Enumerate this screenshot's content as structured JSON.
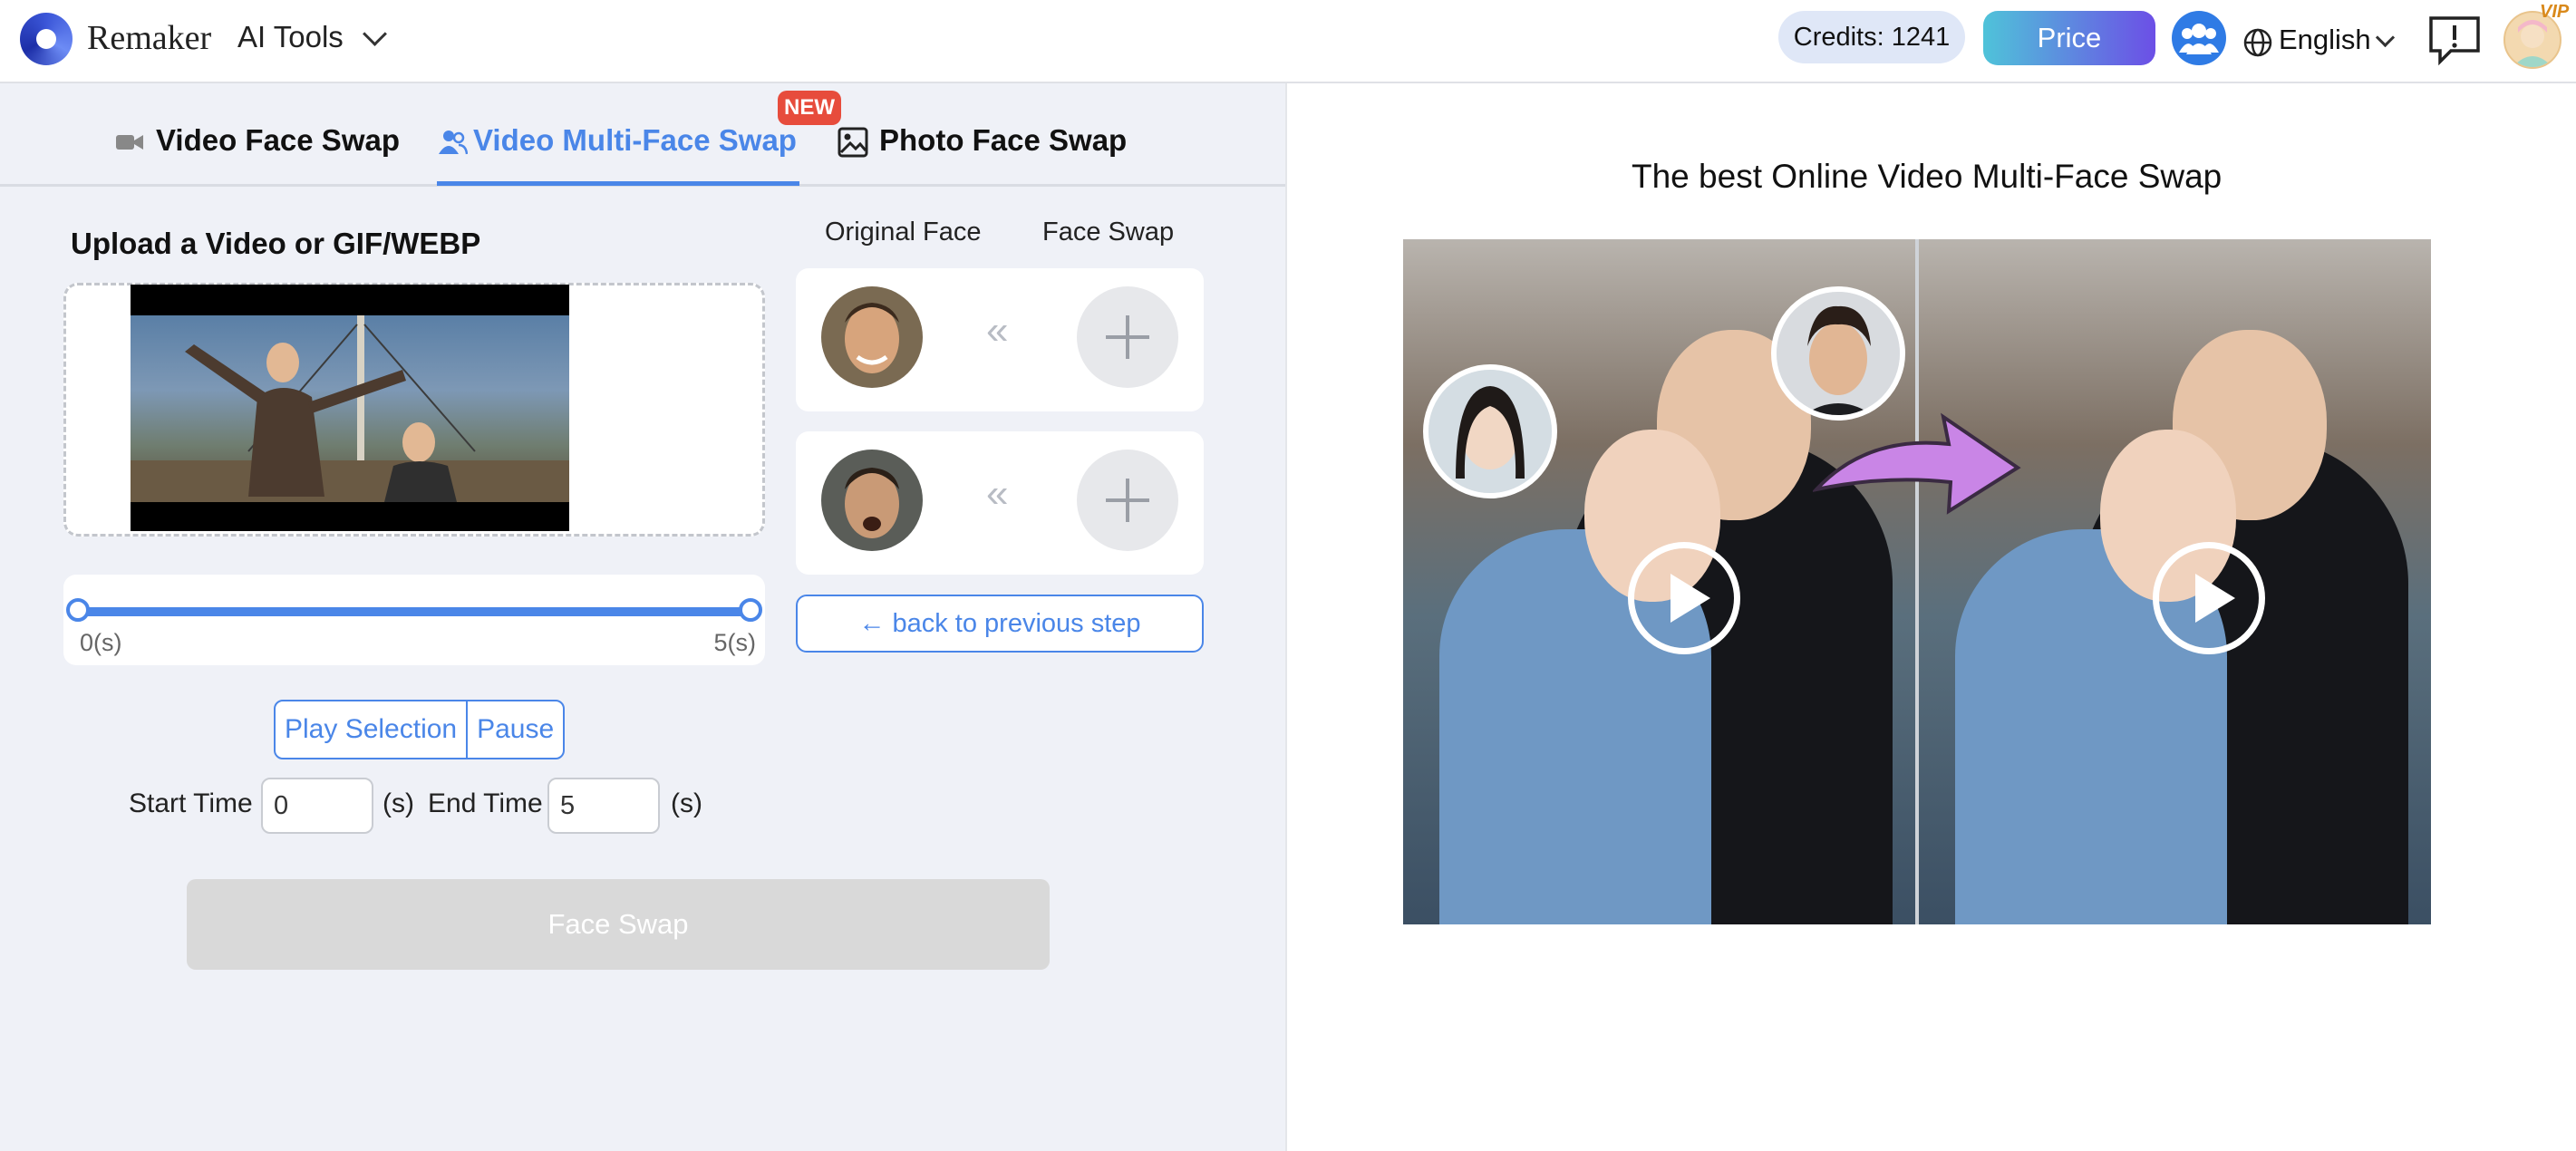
{
  "header": {
    "brand": "Remaker",
    "ai_tools": "AI Tools",
    "credits": "Credits: 1241",
    "price": "Price",
    "language": "English",
    "vip": "VIP"
  },
  "tabs": [
    {
      "label": "Video Face Swap",
      "active": false
    },
    {
      "label": "Video Multi-Face Swap",
      "active": true,
      "badge": "NEW"
    },
    {
      "label": "Photo Face Swap",
      "active": false
    }
  ],
  "upload": {
    "title": "Upload a Video or GIF/WEBP"
  },
  "slider": {
    "start_label": "0(s)",
    "end_label": "5(s)",
    "start_fraction": 0,
    "end_fraction": 1
  },
  "playback": {
    "play_selection": "Play Selection",
    "pause": "Pause"
  },
  "time": {
    "start_label": "Start Time",
    "start_value": "0",
    "start_unit": "(s)",
    "end_label": "End Time",
    "end_value": "5",
    "end_unit": "(s)"
  },
  "face_swap_button": "Face Swap",
  "faces": {
    "original_header": "Original Face",
    "swap_header": "Face Swap",
    "arrow_glyph": "«",
    "back_button": "← back to previous step"
  },
  "demo": {
    "title": "The best Online Video Multi-Face Swap"
  },
  "colors": {
    "accent": "#4a86e8",
    "badge": "#e74c3c",
    "left_panel_bg": "#eff1f7",
    "disabled_button": "#d9d9d9"
  }
}
